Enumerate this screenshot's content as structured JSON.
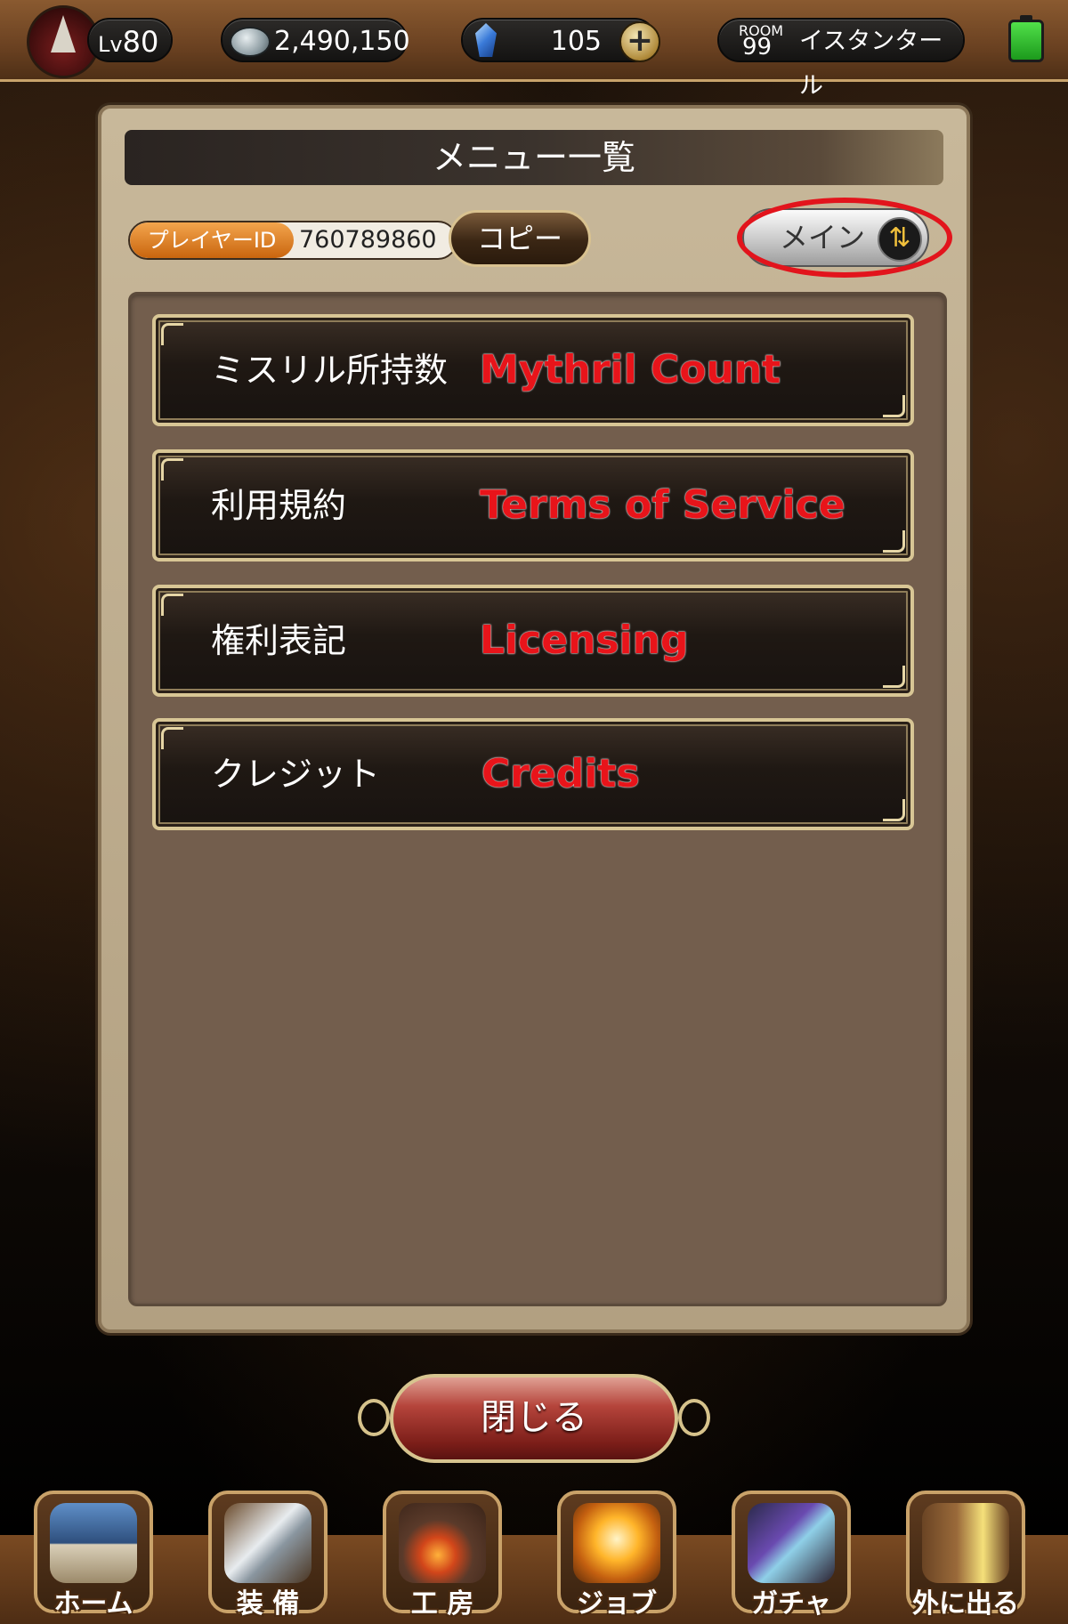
{
  "status_bar": {
    "level_prefix": "Lv",
    "level_value": "80",
    "gil": "2,490,150",
    "crystals": "105",
    "room_label": "ROOM",
    "room_number": "99",
    "location": "イスタンタール"
  },
  "panel": {
    "title": "メニュー一覧",
    "player_id_label": "プレイヤーID",
    "player_id": "760789860",
    "copy_button": "コピー",
    "main_toggle": "メイン"
  },
  "menu_items": [
    {
      "label_jp": "ミスリル所持数",
      "label_en": "Mythril Count"
    },
    {
      "label_jp": "利用規約",
      "label_en": "Terms of Service"
    },
    {
      "label_jp": "権利表記",
      "label_en": "Licensing"
    },
    {
      "label_jp": "クレジット",
      "label_en": "Credits"
    }
  ],
  "close_button": "閉じる",
  "bottom_nav": [
    {
      "label": "ホーム",
      "icon": "home-tent-icon"
    },
    {
      "label": "装 備",
      "icon": "equipment-sword-icon"
    },
    {
      "label": "工 房",
      "icon": "workshop-furnace-icon"
    },
    {
      "label": "ジョブ",
      "icon": "job-crystal-icon"
    },
    {
      "label": "ガチャ",
      "icon": "gacha-weapons-icon"
    },
    {
      "label": "外に出る",
      "icon": "exit-door-icon"
    }
  ],
  "colors": {
    "annotation_red": "#e8141a",
    "highlight_ring": "#e2141c",
    "player_id_orange": "#d9791f"
  }
}
